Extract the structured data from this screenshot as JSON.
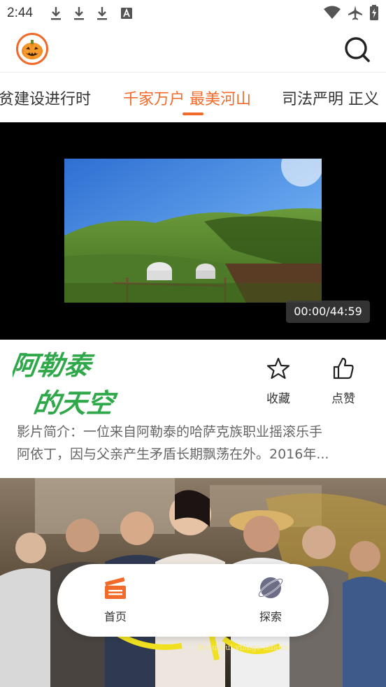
{
  "status_bar": {
    "time": "2:44",
    "icons": [
      "download-icon",
      "download-icon",
      "download-icon",
      "a-icon",
      "wifi-icon",
      "airplane-icon",
      "battery-charging-icon"
    ]
  },
  "appbar": {
    "logo_icon": "pumpkin-icon",
    "search_icon": "search-icon"
  },
  "tabs": [
    {
      "label": "扶贫建设进行时"
    },
    {
      "label": "千家万户 最美河山"
    },
    {
      "label": "司法严明 正义"
    }
  ],
  "active_tab_index": 1,
  "player": {
    "duration": "00:00/44:59"
  },
  "info": {
    "title_calligraphy": "阿勒泰的天空",
    "favorite_label": "收藏",
    "like_label": "点赞",
    "synopsis_line1": "影片简介：一位来自阿勒泰的哈萨克族职业摇滚乐手",
    "synopsis_line2": "阿依丁，因与父亲产生矛盾长期飘荡在外。2016年..."
  },
  "poster": {
    "subtitle": "Beautiful village affairs"
  },
  "bottom_nav": {
    "home_label": "首页",
    "explore_label": "探索"
  },
  "colors": {
    "accent": "#f26a2a",
    "text": "#333333",
    "muted": "#666666"
  }
}
